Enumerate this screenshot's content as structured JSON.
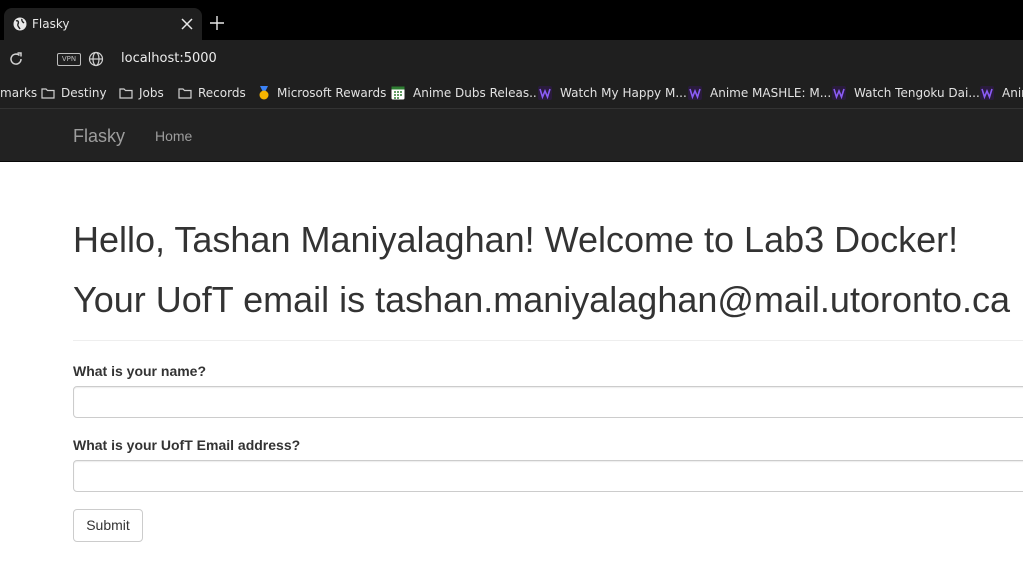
{
  "browser": {
    "tab": {
      "title": "Flasky"
    },
    "address_bar": {
      "url": "localhost:5000",
      "vpn_label": "VPN"
    },
    "bookmarks": [
      {
        "label": "marks",
        "icon": "none"
      },
      {
        "label": "Destiny",
        "icon": "folder-icon"
      },
      {
        "label": "Jobs",
        "icon": "folder-icon"
      },
      {
        "label": "Records",
        "icon": "folder-icon"
      },
      {
        "label": "Microsoft Rewards",
        "icon": "medal-icon"
      },
      {
        "label": "Anime Dubs Releas...",
        "icon": "calendar-grid-icon"
      },
      {
        "label": "Watch My Happy M...",
        "icon": "w-logo-icon"
      },
      {
        "label": "Anime MASHLE: M...",
        "icon": "w-logo-icon"
      },
      {
        "label": "Watch Tengoku Dai...",
        "icon": "w-logo-icon"
      },
      {
        "label": "Anim",
        "icon": "w-logo-icon"
      }
    ]
  },
  "navbar": {
    "brand": "Flasky",
    "links": [
      {
        "label": "Home"
      }
    ]
  },
  "page": {
    "greeting": "Hello, Tashan Maniyalaghan! Welcome to Lab3 Docker!",
    "email_line": "Your UofT email is tashan.maniyalaghan@mail.utoronto.ca",
    "form": {
      "name_label": "What is your name?",
      "name_value": "",
      "email_label": "What is your UofT Email address?",
      "email_value": "",
      "submit_label": "Submit"
    }
  },
  "colors": {
    "navbar_bg": "#222222",
    "nav_text": "#9d9d9d",
    "body_text": "#333333",
    "chrome_bg": "#1f1f1f"
  }
}
